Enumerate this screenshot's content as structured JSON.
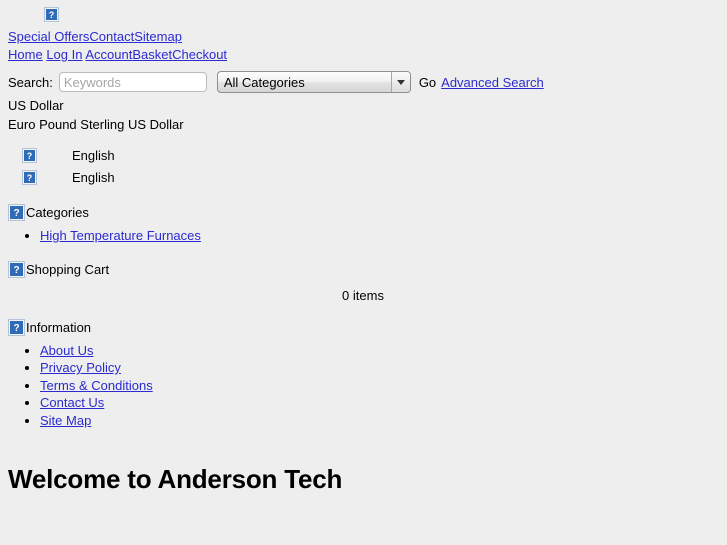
{
  "header": {
    "logo_icon": "broken-image-icon"
  },
  "top_nav": {
    "row1": [
      {
        "label": "Special Offers"
      },
      {
        "label": "Contact"
      },
      {
        "label": "Sitemap"
      }
    ],
    "row2": [
      {
        "label": "Home"
      },
      {
        "label": "Log In"
      },
      {
        "label": "Account"
      },
      {
        "label": "Basket"
      },
      {
        "label": "Checkout"
      }
    ]
  },
  "search": {
    "label": "Search:",
    "placeholder": "Keywords",
    "value": "",
    "category_selected": "All Categories",
    "go_label": "Go",
    "advanced_label": "Advanced Search"
  },
  "currency": {
    "current": "US Dollar",
    "options_line": "Euro Pound Sterling US Dollar"
  },
  "languages": [
    {
      "label": "English",
      "icon": "broken-image-icon"
    },
    {
      "label": "English",
      "icon": "broken-image-icon"
    }
  ],
  "categories": {
    "heading": "Categories",
    "icon": "broken-image-icon",
    "items": [
      {
        "label": "High Temperature Furnaces"
      }
    ]
  },
  "cart": {
    "heading": "Shopping Cart",
    "icon": "broken-image-icon",
    "items_text": "0 items"
  },
  "information": {
    "heading": "Information",
    "icon": "broken-image-icon",
    "items": [
      {
        "label": "About Us"
      },
      {
        "label": "Privacy Policy"
      },
      {
        "label": "Terms & Conditions"
      },
      {
        "label": "Contact Us"
      },
      {
        "label": "Site Map"
      }
    ]
  },
  "main": {
    "welcome_heading": "Welcome to Anderson Tech"
  },
  "colors": {
    "background": "#eeeeee",
    "link": "#2b2bd1",
    "text": "#000000",
    "broken_icon": "#2f6cb5"
  }
}
